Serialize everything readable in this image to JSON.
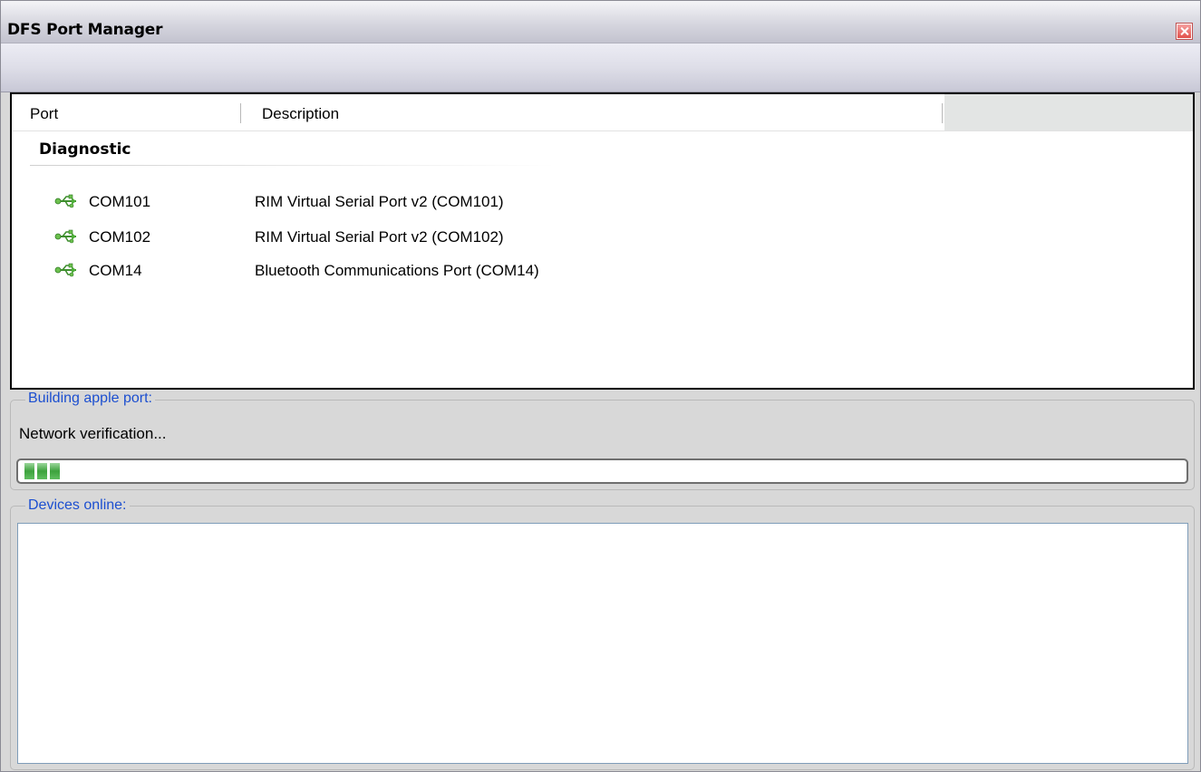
{
  "window": {
    "title": "DFS Port Manager"
  },
  "ports_list": {
    "columns": [
      "Port",
      "Description"
    ],
    "group": "Diagnostic",
    "rows": [
      {
        "port": "COM101",
        "description": "RIM Virtual Serial Port v2 (COM101)",
        "icon": "usb-icon"
      },
      {
        "port": "COM102",
        "description": "RIM Virtual Serial Port v2 (COM102)",
        "icon": "usb-icon"
      },
      {
        "port": "COM14",
        "description": "Bluetooth Communications Port (COM14)",
        "icon": "usb-icon"
      }
    ]
  },
  "build_section": {
    "label": "Building apple port:",
    "status": "Network verification...",
    "progress_blocks_filled": 3
  },
  "devices_section": {
    "label": "Devices online:"
  },
  "colors": {
    "groupbox_label": "#1c4fd0",
    "progress_fill": "#3da23d",
    "close_button": "#e2504a"
  }
}
